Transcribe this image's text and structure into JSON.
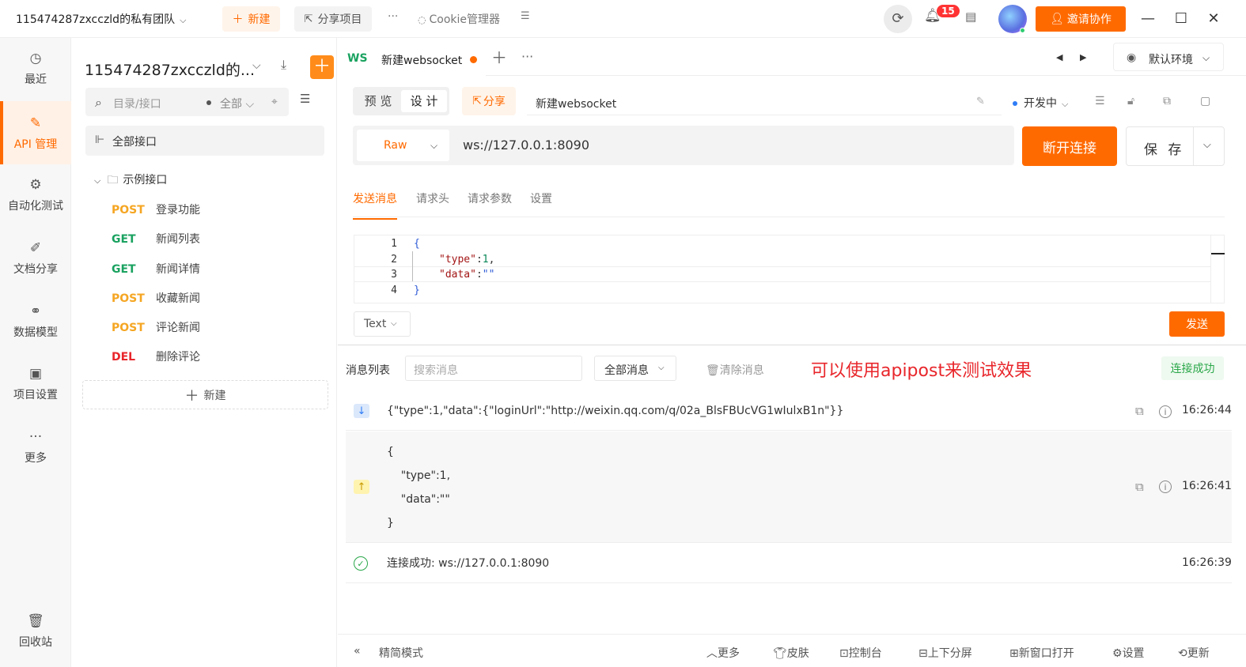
{
  "topbar": {
    "team_name": "115474287zxcczld的私有团队",
    "new_label": "新建",
    "share_project_label": "分享项目",
    "more_label": "···",
    "cookie_manager_label": "Cookie管理器",
    "notification_count": "15",
    "invite_label": "邀请协作"
  },
  "leftnav": {
    "items": [
      {
        "label": "最近",
        "icon": "history-icon"
      },
      {
        "label": "API 管理",
        "icon": "api-icon"
      },
      {
        "label": "自动化测试",
        "icon": "automation-icon"
      },
      {
        "label": "文档分享",
        "icon": "doc-icon"
      },
      {
        "label": "数据模型",
        "icon": "model-icon"
      },
      {
        "label": "项目设置",
        "icon": "settings-icon"
      },
      {
        "label": "更多",
        "icon": "more-icon"
      }
    ],
    "trash_label": "回收站"
  },
  "tree": {
    "project_title": "115474287zxcczld的...",
    "search_placeholder": "目录/接口",
    "filter_label": "全部",
    "all_api_label": "全部接口",
    "folder_label": "示例接口",
    "apis": [
      {
        "method": "POST",
        "name": "登录功能",
        "color": "#f5a623"
      },
      {
        "method": "GET",
        "name": "新闻列表",
        "color": "#1aa260"
      },
      {
        "method": "GET",
        "name": "新闻详情",
        "color": "#1aa260"
      },
      {
        "method": "POST",
        "name": "收藏新闻",
        "color": "#f5a623"
      },
      {
        "method": "POST",
        "name": "评论新闻",
        "color": "#f5a623"
      },
      {
        "method": "DEL",
        "name": "删除评论",
        "color": "#e8262b"
      }
    ],
    "new_label": "新建"
  },
  "tabs": {
    "ws_tag": "WS",
    "ws_name": "新建websocket",
    "environment": "默认环境"
  },
  "toolbar": {
    "preview_label": "预 览",
    "design_label": "设 计",
    "share_label": "分享",
    "doc_name": "新建websocket",
    "status_label": "开发中"
  },
  "request": {
    "mode": "Raw",
    "url": "ws://127.0.0.1:8090",
    "disconnect_label": "断开连接",
    "save_label": "保 存"
  },
  "subtabs": [
    "发送消息",
    "请求头",
    "请求参数",
    "设置"
  ],
  "editor": {
    "line_numbers": [
      "1",
      "2",
      "3",
      "4"
    ],
    "lines": {
      "l1": "{",
      "l2_key": "\"type\"",
      "l2_colon": ":",
      "l2_val": "1",
      "l2_comma": ",",
      "l3_key": "\"data\"",
      "l3_colon": ":",
      "l3_val": "\"\"",
      "l4": "}"
    },
    "format": "Text",
    "send_label": "发送"
  },
  "messages": {
    "title": "消息列表",
    "search_placeholder": "搜索消息",
    "filter": "全部消息",
    "clear_label": "清除消息",
    "note": "可以使用apipost来测试效果",
    "status": "连接成功",
    "items": [
      {
        "direction": "received",
        "body": "{\"type\":1,\"data\":{\"loginUrl\":\"http://weixin.qq.com/q/02a_BlsFBUcVG1wIulxB1n\"}}",
        "time": "16:26:44"
      },
      {
        "direction": "sent",
        "body": "{\n    \"type\":1,\n    \"data\":\"\"\n}",
        "time": "16:26:41"
      },
      {
        "direction": "system",
        "body": "连接成功: ws://127.0.0.1:8090",
        "time": "16:26:39"
      }
    ]
  },
  "footer": {
    "simple_mode": "精简模式",
    "more": "更多",
    "skin": "皮肤",
    "console": "控制台",
    "split": "上下分屏",
    "new_window": "新窗口打开",
    "settings": "设置",
    "update": "更新"
  },
  "colors": {
    "accent": "#ff6a00",
    "get": "#1aa260",
    "post": "#f5a623",
    "del": "#e8262b"
  }
}
